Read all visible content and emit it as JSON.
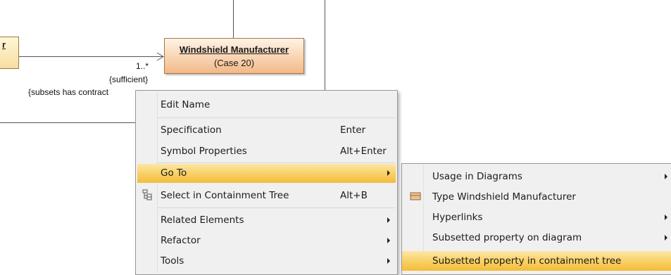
{
  "diagram": {
    "left_box_text": "r",
    "class_title": "Windshield Manufacturer",
    "class_subtitle": "(Case 20)",
    "multiplicity": "1..*",
    "constraint1": "{sufficient}",
    "constraint2": "{subsets has contract"
  },
  "menu": {
    "items": [
      {
        "label": "Edit Name",
        "shortcut": ""
      },
      {
        "label": "Specification",
        "shortcut": "Enter"
      },
      {
        "label": "Symbol Properties",
        "shortcut": "Alt+Enter"
      },
      {
        "label": "Go To",
        "shortcut": ""
      },
      {
        "label": "Select in Containment Tree",
        "shortcut": "Alt+B",
        "icon": "containment-tree-icon"
      },
      {
        "label": "Related Elements",
        "shortcut": ""
      },
      {
        "label": "Refactor",
        "shortcut": ""
      },
      {
        "label": "Tools",
        "shortcut": ""
      }
    ]
  },
  "submenu": {
    "items": [
      {
        "label": "Usage in Diagrams"
      },
      {
        "label": "Type Windshield Manufacturer",
        "icon": "class-type-icon"
      },
      {
        "label": "Hyperlinks"
      },
      {
        "label": "Subsetted property on diagram"
      },
      {
        "label": "Subsetted property in containment tree"
      }
    ]
  },
  "colors": {
    "highlight": "#f8cf62",
    "class_fill": "#f8d4b2",
    "menu_bg": "#f0f0f0"
  }
}
